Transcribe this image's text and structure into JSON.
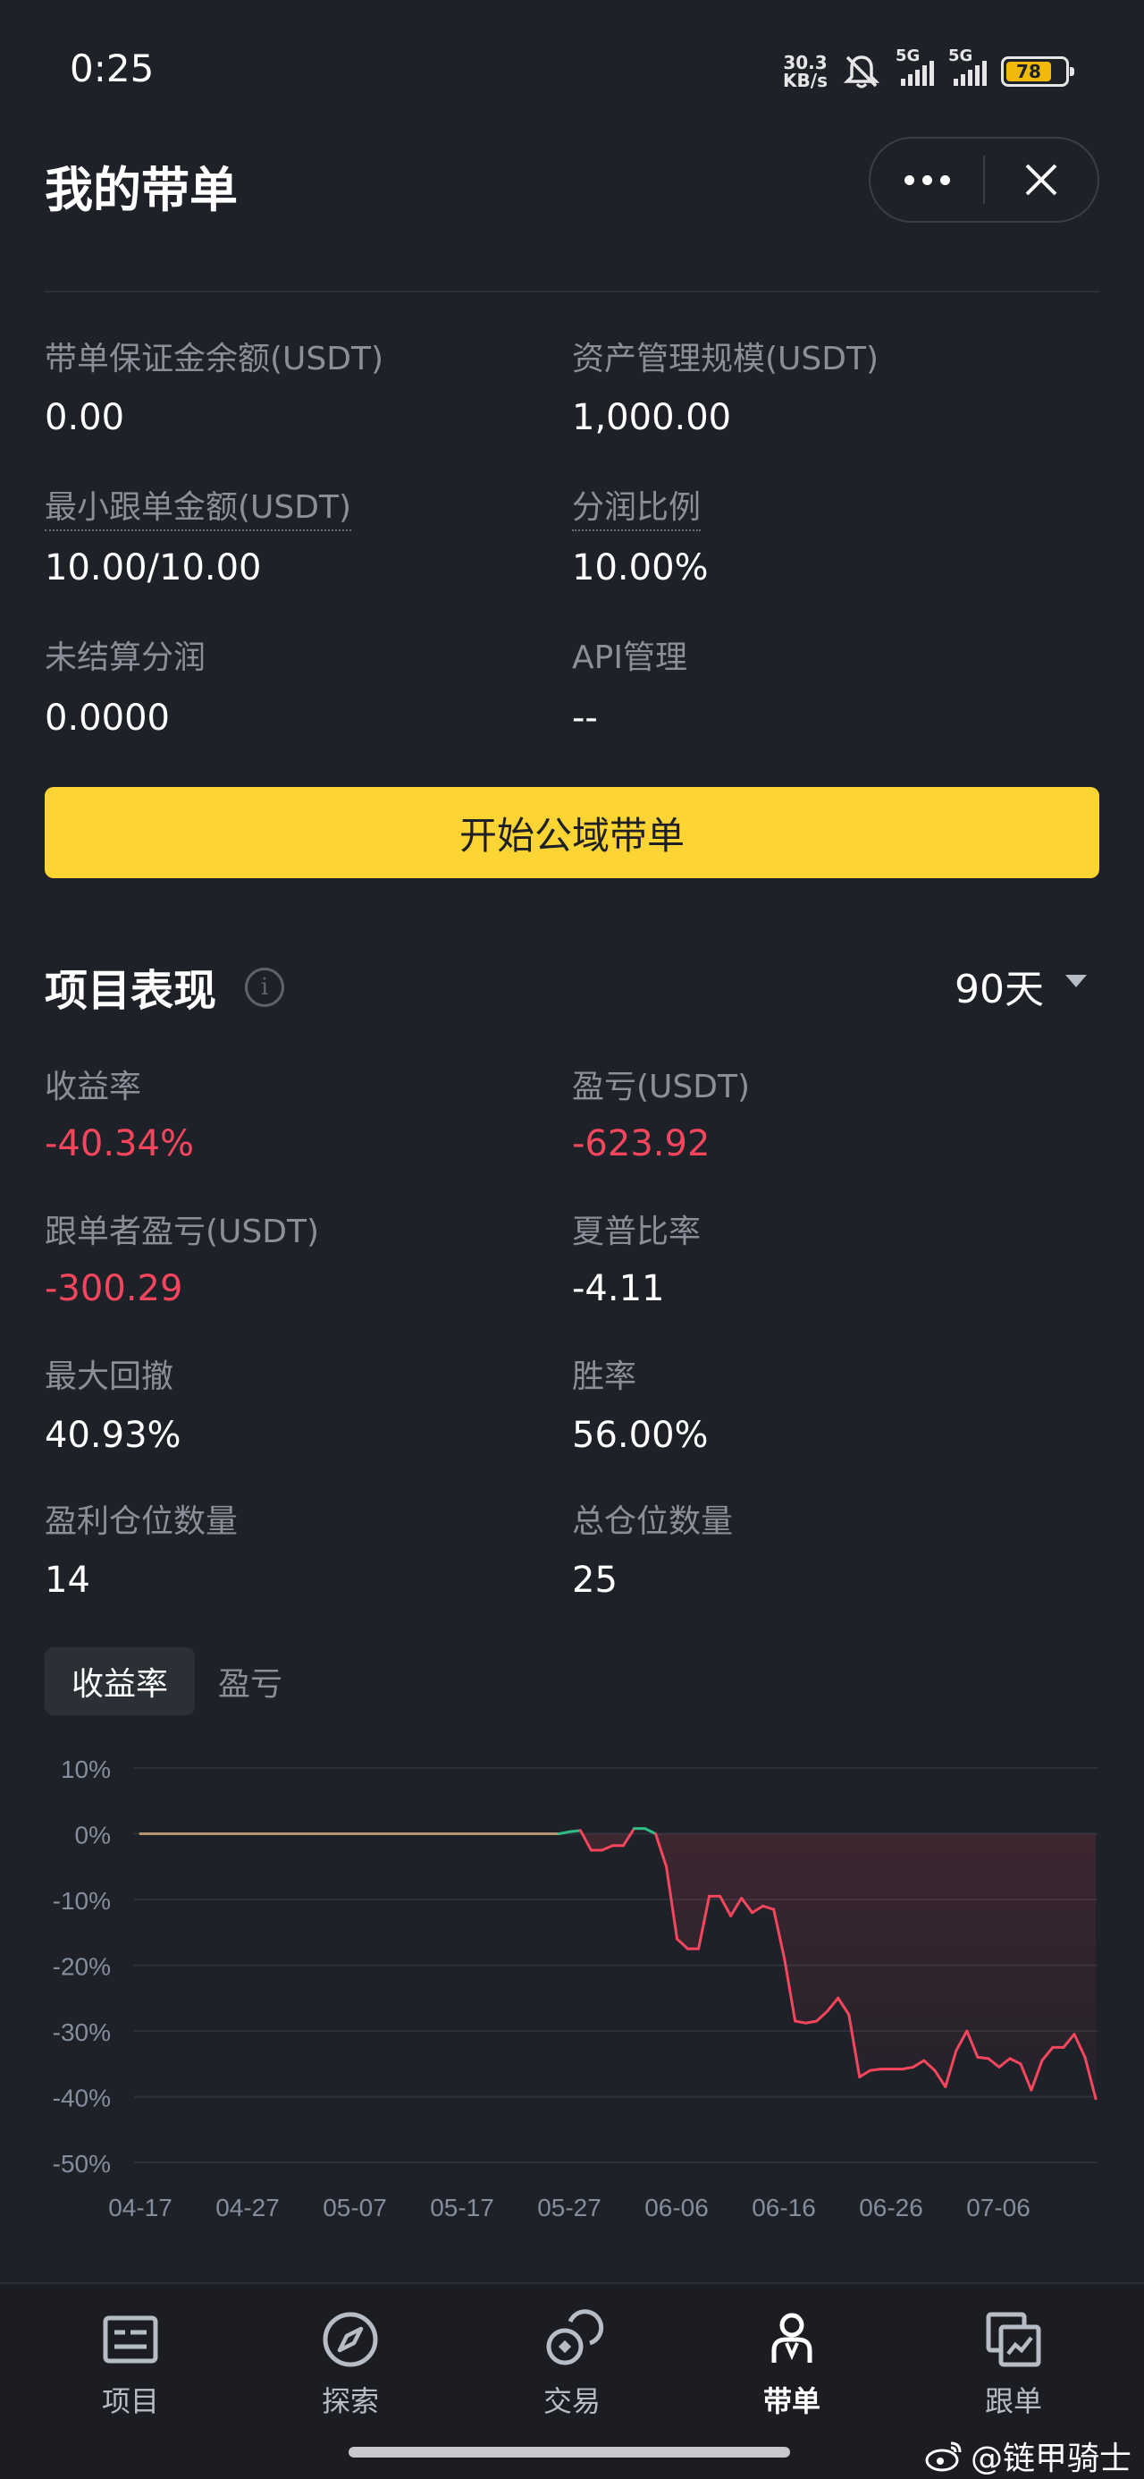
{
  "status_bar": {
    "time": "0:25",
    "net_speed_value": "30.3",
    "net_speed_unit": "KB/s",
    "signal1_label": "5G",
    "signal2_label": "5G",
    "battery": "78"
  },
  "header": {
    "title": "我的带单",
    "more_icon": "more-dots-icon",
    "close_icon": "close-icon"
  },
  "account": {
    "margin_balance_label": "带单保证金余额(USDT)",
    "margin_balance_value": "0.00",
    "aum_label": "资产管理规模(USDT)",
    "aum_value": "1,000.00",
    "min_copy_label": "最小跟单金额(USDT)",
    "min_copy_value": "10.00/10.00",
    "profit_share_label": "分润比例",
    "profit_share_value": "10.00%",
    "unsettled_label": "未结算分润",
    "unsettled_value": "0.0000",
    "api_label": "API管理",
    "api_value": "--"
  },
  "start_button": "开始公域带单",
  "performance": {
    "title": "项目表现",
    "period": "90天",
    "roi_label": "收益率",
    "roi_value": "-40.34%",
    "pnl_label": "盈亏(USDT)",
    "pnl_value": "-623.92",
    "copier_pnl_label": "跟单者盈亏(USDT)",
    "copier_pnl_value": "-300.29",
    "sharpe_label": "夏普比率",
    "sharpe_value": "-4.11",
    "mdd_label": "最大回撤",
    "mdd_value": "40.93%",
    "winrate_label": "胜率",
    "winrate_value": "56.00%",
    "win_positions_label": "盈利仓位数量",
    "win_positions_value": "14",
    "total_positions_label": "总仓位数量",
    "total_positions_value": "25"
  },
  "chart_tabs": {
    "active": "收益率",
    "inactive": "盈亏"
  },
  "colors": {
    "accent": "#fcd535",
    "negative": "#f6465d",
    "positive": "#2ebd85",
    "background": "#1f2129"
  },
  "chart_data": {
    "type": "line",
    "ylim": [
      -50,
      10
    ],
    "y_ticks": [
      "10%",
      "0%",
      "-10%",
      "-20%",
      "-30%",
      "-40%",
      "-50%"
    ],
    "y_tick_values": [
      10,
      0,
      -10,
      -20,
      -30,
      -40,
      -50
    ],
    "x_ticks": [
      "04-17",
      "04-27",
      "05-07",
      "05-17",
      "05-27",
      "06-06",
      "06-16",
      "06-26",
      "07-06"
    ],
    "grid": true,
    "series": [
      {
        "values": [
          0,
          0,
          0,
          0,
          0,
          0,
          0,
          0,
          0,
          0,
          0,
          0,
          0,
          0,
          0,
          0,
          0,
          0,
          0,
          0,
          0,
          0,
          0,
          0,
          0,
          0,
          0,
          0,
          0,
          0,
          0,
          0,
          0,
          0,
          0,
          0,
          0,
          0,
          0,
          0,
          0.3,
          0.5,
          -2.5,
          -2.5,
          -1.8,
          -1.8,
          0.8,
          0.8,
          0,
          -5,
          -16,
          -17.5,
          -17.5,
          -9.5,
          -9.5,
          -12.5,
          -9.8,
          -12,
          -11,
          -11.5,
          -19,
          -28.5,
          -28.8,
          -28.5,
          -27,
          -25,
          -27.5,
          -37,
          -36,
          -35.8,
          -35.8,
          -35.8,
          -35.5,
          -34.5,
          -36,
          -38.5,
          -33,
          -30,
          -34,
          -34.2,
          -35.5,
          -34.2,
          -35,
          -39,
          -34.5,
          -32.5,
          -32.5,
          -30.5,
          -34,
          -40.3
        ]
      }
    ]
  },
  "nav": {
    "items": [
      {
        "label": "项目",
        "icon": "project-icon"
      },
      {
        "label": "探索",
        "icon": "compass-icon"
      },
      {
        "label": "交易",
        "icon": "trade-icon"
      },
      {
        "label": "带单",
        "icon": "lead-trader-icon"
      },
      {
        "label": "跟单",
        "icon": "copy-trade-icon"
      }
    ]
  },
  "watermark": "@链甲骑士"
}
